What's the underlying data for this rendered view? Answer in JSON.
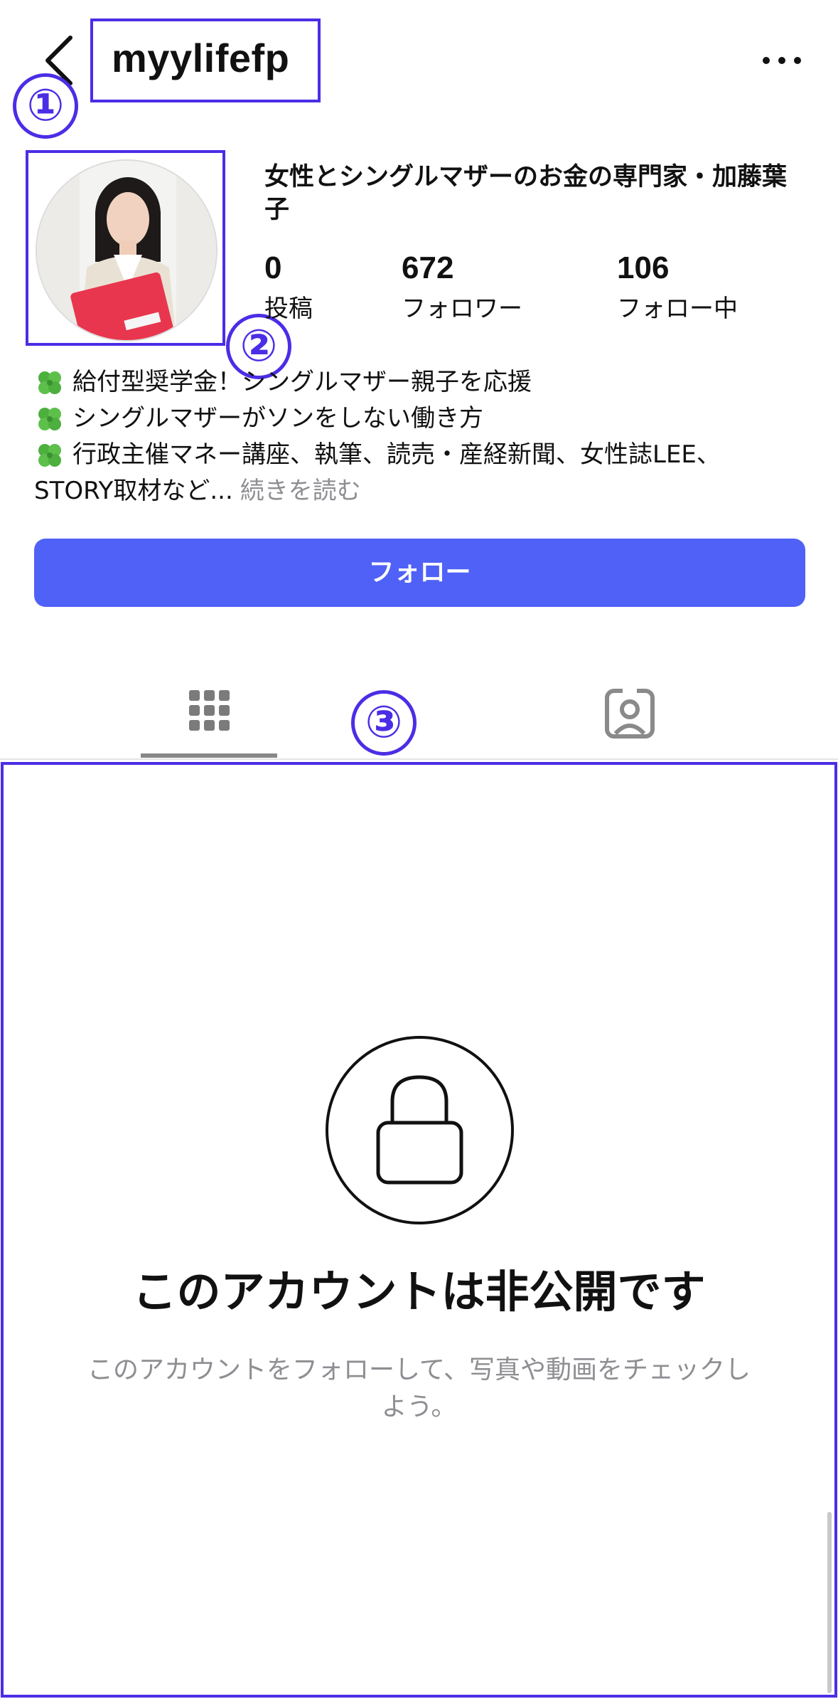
{
  "header": {
    "username": "myylifefp",
    "back_icon": "chevron-left-icon",
    "more_icon": "ellipsis-icon"
  },
  "annotations": {
    "marker_1": "①",
    "marker_2": "②",
    "marker_3": "③",
    "highlight_color": "#4a2ee6"
  },
  "profile": {
    "display_name": "女性とシングルマザーのお金の専門家・加藤葉子",
    "stats": [
      {
        "value": "0",
        "label": "投稿"
      },
      {
        "value": "672",
        "label": "フォロワー"
      },
      {
        "value": "106",
        "label": "フォロー中"
      }
    ],
    "bio_lines": [
      "給付型奨学金！シングルマザー親子を応援",
      "シングルマザーがソンをしない働き方",
      "行政主催マネー講座、執筆、読売・産経新聞、女性誌LEE、"
    ],
    "bio_last_line": "STORY取材など...",
    "read_more": "続きを読む",
    "bio_icon": "four-leaf-clover-icon"
  },
  "actions": {
    "follow_label": "フォロー",
    "follow_color": "#4f61f6"
  },
  "tabs": [
    {
      "icon": "grid-icon",
      "active": true
    },
    {
      "icon": "tagged-person-icon",
      "active": false
    }
  ],
  "private": {
    "icon": "lock-icon",
    "title": "このアカウントは非公開です",
    "description": "このアカウントをフォローして、写真や動画をチェックしよう。"
  }
}
